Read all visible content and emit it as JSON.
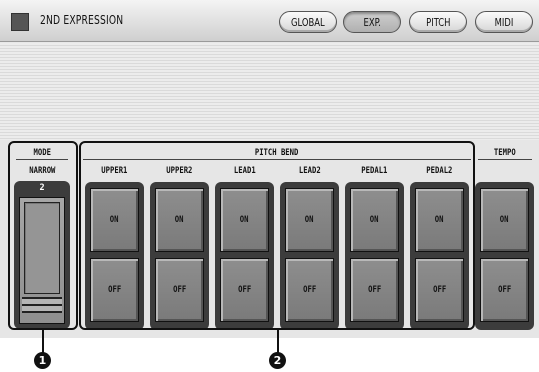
{
  "title": "2ND EXPRESSION",
  "tabs": [
    {
      "label": "GLOBAL"
    },
    {
      "label": "EXP."
    },
    {
      "label": "PITCH"
    },
    {
      "label": "MIDI"
    }
  ],
  "mode": {
    "header": "MODE",
    "value_label": "NARROW",
    "value": "2"
  },
  "pitch_bend": {
    "header": "PITCH BEND",
    "columns": [
      {
        "label": "UPPER1",
        "on": "ON",
        "off": "OFF"
      },
      {
        "label": "UPPER2",
        "on": "ON",
        "off": "OFF"
      },
      {
        "label": "LEAD1",
        "on": "ON",
        "off": "OFF"
      },
      {
        "label": "LEAD2",
        "on": "ON",
        "off": "OFF"
      },
      {
        "label": "PEDAL1",
        "on": "ON",
        "off": "OFF"
      },
      {
        "label": "PEDAL2",
        "on": "ON",
        "off": "OFF"
      }
    ]
  },
  "tempo": {
    "header": "TEMPO",
    "on": "ON",
    "off": "OFF"
  },
  "callouts": [
    "1",
    "2"
  ]
}
